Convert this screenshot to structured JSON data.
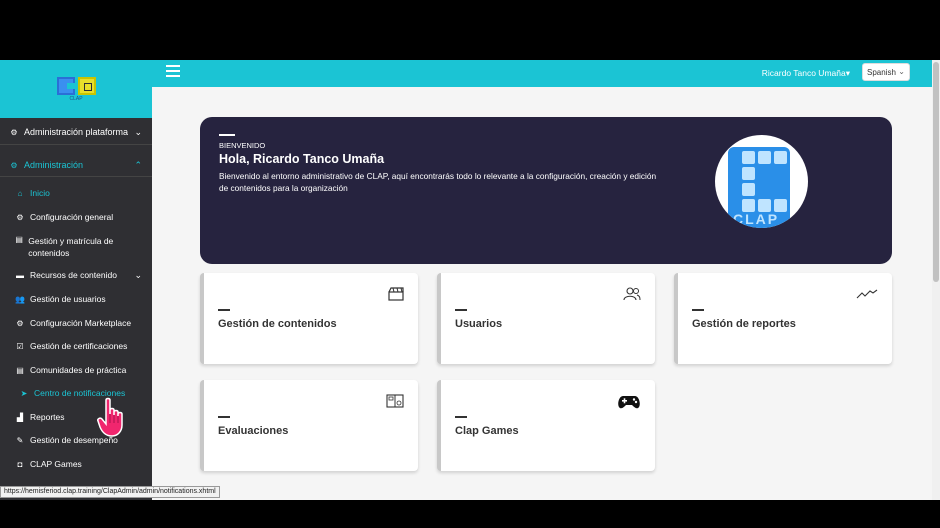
{
  "sidebar": {
    "logo_sub": "CLAP",
    "sections": [
      {
        "label": "Administración plataforma",
        "icon": "cogs-icon"
      },
      {
        "label": "Administración",
        "icon": "cogs-icon"
      }
    ],
    "items": [
      {
        "label": "Inicio",
        "icon": "home-icon"
      },
      {
        "label": "Configuración general",
        "icon": "gear-icon"
      },
      {
        "label": "Gestión y matrícula de contenidos",
        "icon": "book-icon"
      },
      {
        "label": "Recursos de contenido",
        "icon": "folder-icon"
      },
      {
        "label": "Gestión de usuarios",
        "icon": "users-icon"
      },
      {
        "label": "Configuración Marketplace",
        "icon": "gear-icon"
      },
      {
        "label": "Gestión de certificaciones",
        "icon": "check-square-icon"
      },
      {
        "label": "Comunidades de práctica",
        "icon": "book-icon"
      },
      {
        "label": "Centro de notificaciones",
        "icon": "paper-plane-icon"
      },
      {
        "label": "Reportes",
        "icon": "chart-icon"
      },
      {
        "label": "Gestión de desempeño",
        "icon": "pencil-icon"
      },
      {
        "label": "CLAP Games",
        "icon": "gamepad-icon"
      }
    ]
  },
  "topbar": {
    "user": "Ricardo Tanco Umaña",
    "language": "Spanish"
  },
  "hero": {
    "kicker": "BIENVENIDO",
    "title": "Hola, Ricardo Tanco Umaña",
    "description": "Bienvenido al entorno administrativo de CLAP, aquí encontrarás todo lo relevante a la configuración, creación y edición de contenidos para la organización",
    "logo_text": "CLAP"
  },
  "cards": [
    {
      "label": "Gestión de contenidos",
      "icon": "clapperboard-icon"
    },
    {
      "label": "Usuarios",
      "icon": "users-icon"
    },
    {
      "label": "Gestión de reportes",
      "icon": "trend-icon"
    },
    {
      "label": "Evaluaciones",
      "icon": "quiz-icon"
    },
    {
      "label": "Clap Games",
      "icon": "gamepad-icon"
    }
  ],
  "status_url": "https://hemisferiod.clap.training/ClapAdmin/admin/notifications.xhtml",
  "colors": {
    "accent": "#1bc4d4",
    "sidebar": "#2f2f33",
    "hero": "#26233f"
  }
}
